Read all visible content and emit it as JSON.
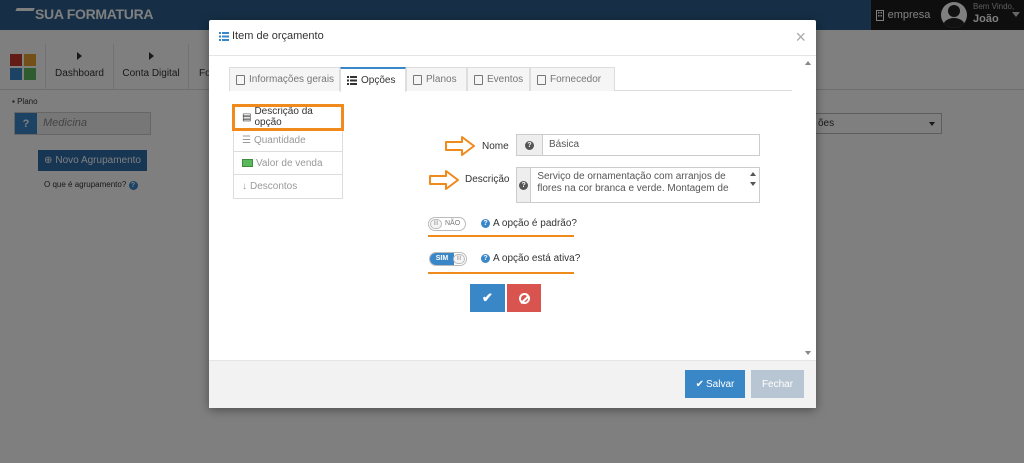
{
  "app": {
    "brand": "SUA FORMATURA",
    "empresa": "empresa",
    "welcome": "Bem Vindo,",
    "user": "João"
  },
  "nav": {
    "items": [
      "Dashboard",
      "Conta Digital",
      "Fo"
    ]
  },
  "background": {
    "plano_label": "Plano",
    "plano_value": "Medicina",
    "novo_button": "Novo Agrupamento",
    "oque_link": "O que é agrupamento?",
    "select_value": "ões"
  },
  "modal": {
    "title": "Item de orçamento",
    "close": "×",
    "tabs": [
      {
        "label": "Informações gerais",
        "icon": "file-icon"
      },
      {
        "label": "Opções",
        "icon": "list-icon"
      },
      {
        "label": "Planos",
        "icon": "table-icon"
      },
      {
        "label": "Eventos",
        "icon": "calendar-icon"
      },
      {
        "label": "Fornecedor",
        "icon": "building-icon"
      }
    ],
    "sidebar": [
      {
        "label": "Descrição da opção",
        "icon": "document-icon",
        "active": true
      },
      {
        "label": "Quantidade",
        "icon": "ordered-list-icon",
        "active": false
      },
      {
        "label": "Valor de venda",
        "icon": "money-icon",
        "active": false
      },
      {
        "label": "Descontos",
        "icon": "arrow-down-icon",
        "active": false
      }
    ],
    "form": {
      "nome_label": "Nome",
      "nome_value": "Básica",
      "descricao_label": "Descrição",
      "descricao_value": "Serviço de ornamentação com arranjos de flores na cor branca e verde. Montagem de"
    },
    "toggles": [
      {
        "state": "NÃO",
        "label": "A opção é padrão?"
      },
      {
        "state": "SIM",
        "label": "A opção está ativa?"
      }
    ],
    "footer": {
      "save": "Salvar",
      "close": "Fechar"
    }
  },
  "colors": {
    "primary": "#3a87c8",
    "danger": "#d9534f",
    "highlight": "#f08a1c",
    "topbar": "#2c5f8d"
  }
}
